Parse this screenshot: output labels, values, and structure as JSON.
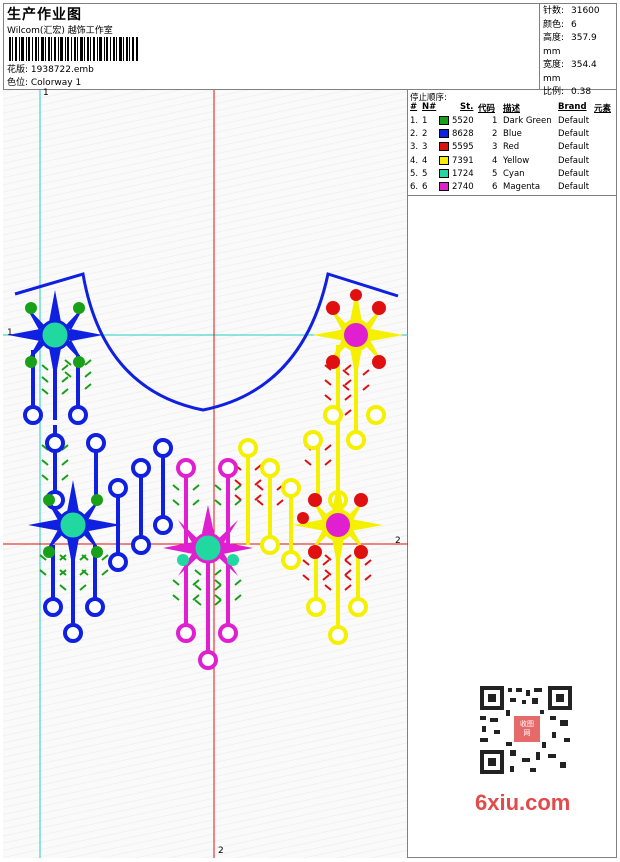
{
  "header": {
    "title": "生产作业图",
    "company": "Wilcom(汇宏) 越饰工作室",
    "filename_label": "花版: 1938722.emb",
    "colorway_label": "色位: Colorway 1"
  },
  "stats": [
    {
      "key": "针数:",
      "value": "31600"
    },
    {
      "key": "颜色:",
      "value": "6"
    },
    {
      "key": "高度:",
      "value": "357.9 mm"
    },
    {
      "key": "宽度:",
      "value": "354.4 mm"
    },
    {
      "key": "比例:",
      "value": "0.38"
    }
  ],
  "stop_sequence": {
    "title": "停止顺序:",
    "headers": [
      "#",
      "N#",
      "St.",
      "代码",
      "描述",
      "Brand",
      "元素"
    ],
    "rows": [
      {
        "num": "1.",
        "n": "1",
        "color": "#18a018",
        "st": "5520",
        "code": "1",
        "desc": "Dark Green",
        "brand": "Default"
      },
      {
        "num": "2.",
        "n": "2",
        "color": "#1020e0",
        "st": "8628",
        "code": "2",
        "desc": "Blue",
        "brand": "Default"
      },
      {
        "num": "3.",
        "n": "3",
        "color": "#e01010",
        "st": "5595",
        "code": "3",
        "desc": "Red",
        "brand": "Default"
      },
      {
        "num": "4.",
        "n": "4",
        "color": "#f4f000",
        "st": "7391",
        "code": "4",
        "desc": "Yellow",
        "brand": "Default"
      },
      {
        "num": "5.",
        "n": "5",
        "color": "#20d8a0",
        "st": "1724",
        "code": "5",
        "desc": "Cyan",
        "brand": "Default"
      },
      {
        "num": "6.",
        "n": "6",
        "color": "#e020d0",
        "st": "2740",
        "code": "6",
        "desc": "Magenta",
        "brand": "Default"
      }
    ]
  },
  "axis_labels": {
    "top_v": "1",
    "left_h": "1",
    "right_h": "2",
    "bottom_v": "2"
  },
  "watermark": {
    "site": "6xiu.com",
    "stamp": "收图网"
  },
  "colors": {
    "green": "#18a018",
    "blue": "#1020e0",
    "red": "#e01010",
    "yellow": "#f4f000",
    "cyan": "#20d8a0",
    "magenta": "#e020d0",
    "guide_red": "#e01010",
    "guide_cyan": "#20d0c0"
  }
}
